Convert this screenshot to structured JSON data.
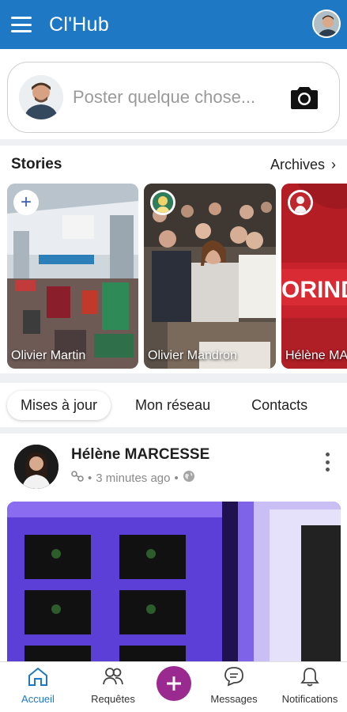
{
  "app": {
    "title": "Cl'Hub",
    "accent_color": "#1f78c4"
  },
  "header": {
    "menu_icon": "hamburger-icon",
    "profile_icon": "avatar"
  },
  "composer": {
    "placeholder": "Poster quelque chose...",
    "camera_icon": "camera-icon"
  },
  "stories": {
    "title": "Stories",
    "archives_label": "Archives",
    "items": [
      {
        "name": "Olivier Martin",
        "badge": "add"
      },
      {
        "name": "Olivier Mandron",
        "badge": "avatar"
      },
      {
        "name": "Hélène MARCESSE",
        "badge": "avatar"
      }
    ]
  },
  "tabs": [
    {
      "label": "Mises à jour",
      "active": true
    },
    {
      "label": "Mon réseau",
      "active": false
    },
    {
      "label": "Contacts",
      "active": false
    }
  ],
  "post": {
    "author": "Hélène MARCESSE",
    "time": "3 minutes ago",
    "link_icon": "link-icon",
    "visibility_icon": "globe-icon"
  },
  "bottom_nav": {
    "items": [
      {
        "label": "Accueil",
        "icon": "home-icon",
        "active": true
      },
      {
        "label": "Requêtes",
        "icon": "people-icon",
        "active": false
      },
      {
        "label": "Messages",
        "icon": "chat-icon",
        "active": false
      },
      {
        "label": "Notifications",
        "icon": "bell-icon",
        "active": false
      }
    ],
    "fab_color": "#9b2a90"
  }
}
